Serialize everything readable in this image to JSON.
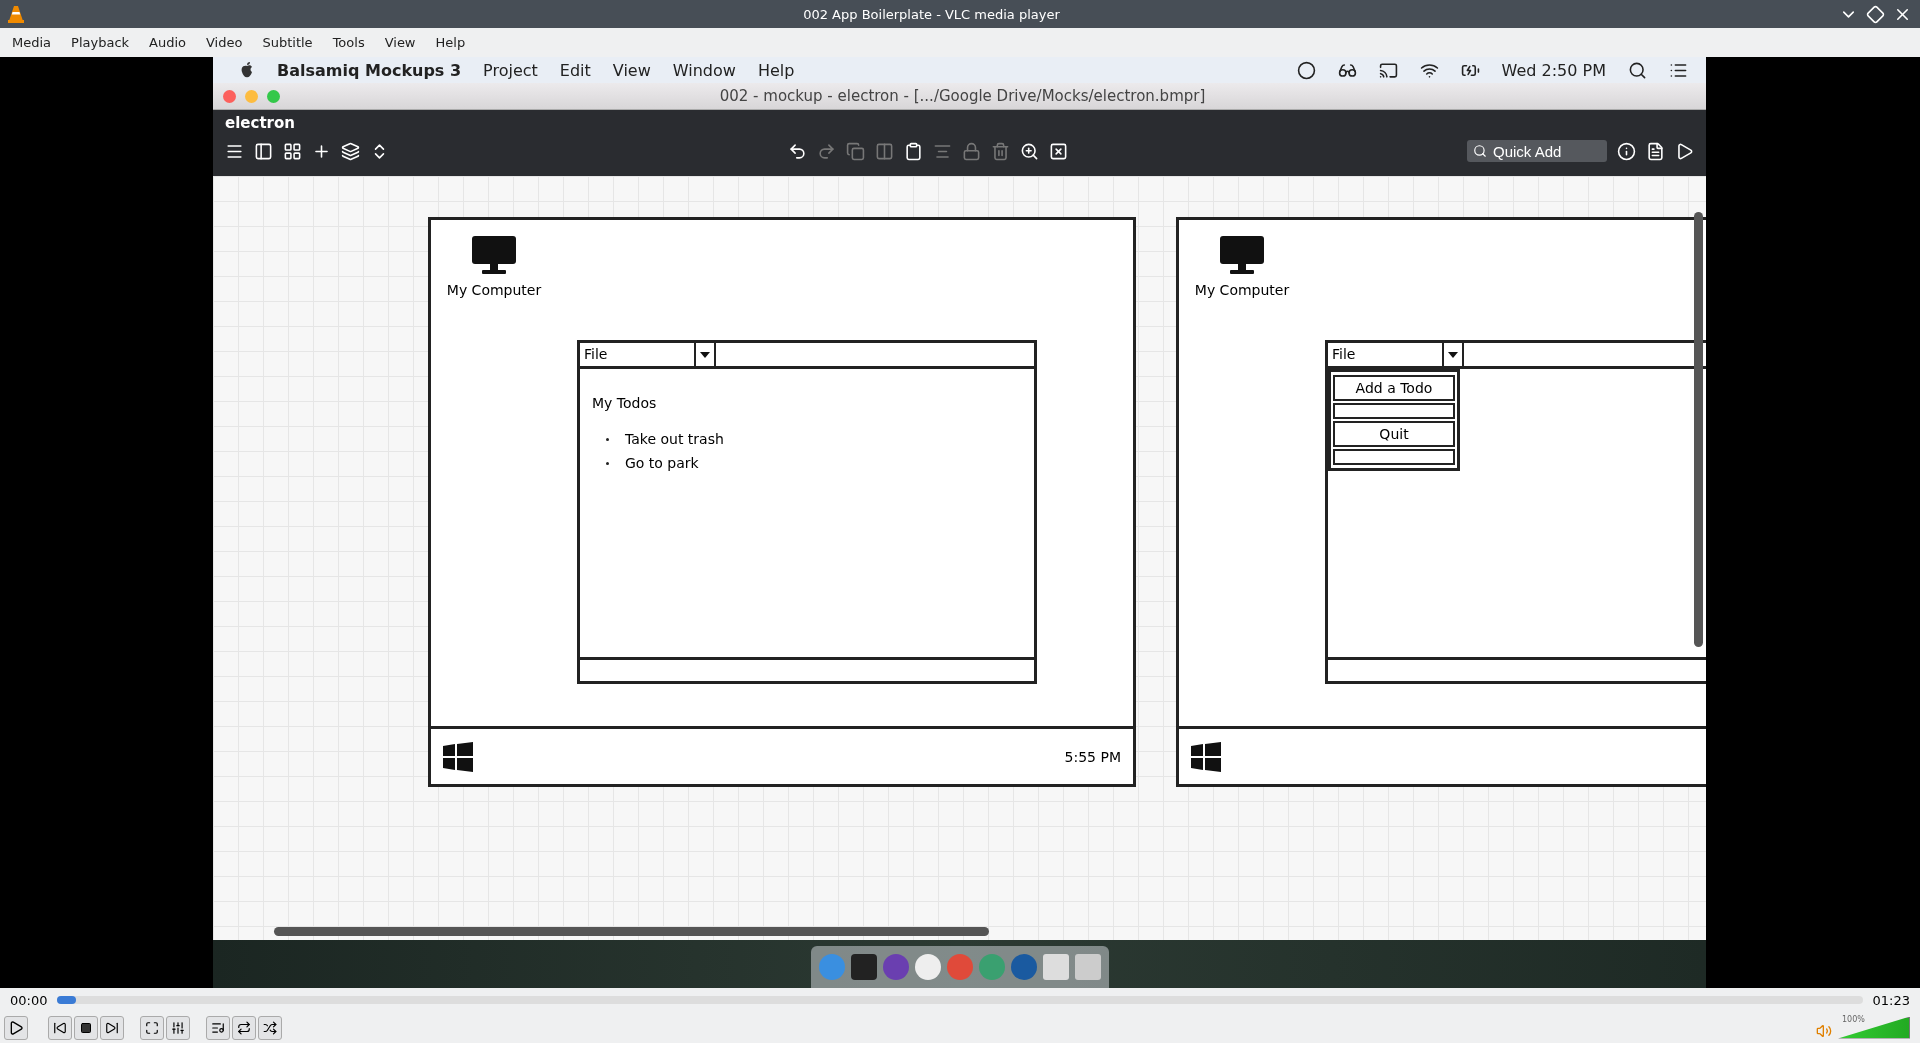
{
  "player": {
    "title": "002 App Boilerplate - VLC media player",
    "menu": [
      "Media",
      "Playback",
      "Audio",
      "Video",
      "Subtitle",
      "Tools",
      "View",
      "Help"
    ],
    "elapsed": "00:00",
    "total": "01:23",
    "progress": {
      "level": 0.01
    },
    "volume": {
      "label": "100%",
      "level": 1.0
    }
  },
  "mac_menubar": {
    "app": "Balsamiq Mockups 3",
    "menus": [
      "Project",
      "Edit",
      "View",
      "Window",
      "Help"
    ],
    "clock": "Wed 2:50 PM"
  },
  "app_window": {
    "title": "002 - mockup - electron - [.../Google Drive/Mocks/electron.bmpr]",
    "project": "electron",
    "quick_add": {
      "placeholder": "Quick Add"
    }
  },
  "mockups": [
    {
      "kind": "todos",
      "desktop_icon": "My Computer",
      "menu": "File",
      "heading": "My Todos",
      "items": [
        "Take out trash",
        "Go to park"
      ],
      "clock": "5:55 PM"
    },
    {
      "kind": "menu",
      "desktop_icon": "My Computer",
      "menu": "File",
      "menu_items": [
        {
          "kind": "item",
          "label": "Add a Todo"
        },
        {
          "kind": "blank"
        },
        {
          "kind": "item",
          "label": "Quit"
        },
        {
          "kind": "blank"
        }
      ]
    }
  ]
}
